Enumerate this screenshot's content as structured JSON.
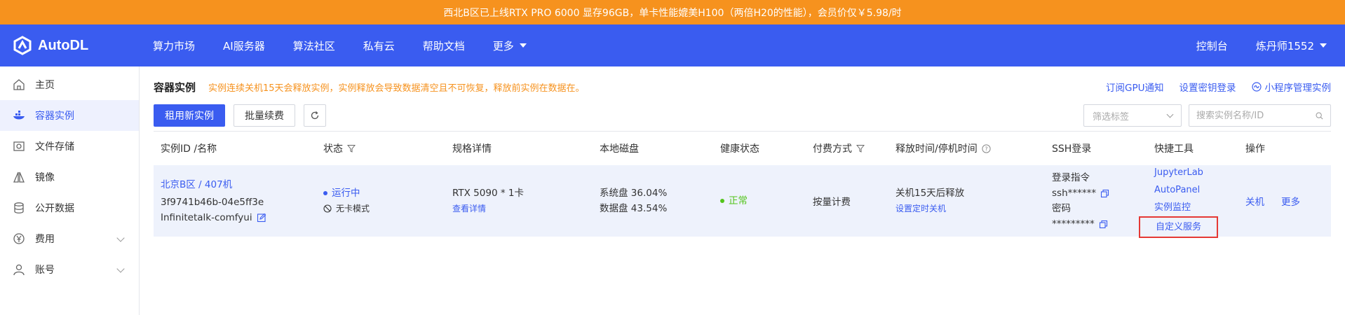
{
  "banner": {
    "text": "西北B区已上线RTX PRO 6000 显存96GB，单卡性能媲美H100（两倍H20的性能），会员价仅￥5.98/时"
  },
  "topnav": {
    "logo": "AutoDL",
    "items": [
      {
        "label": "算力市场"
      },
      {
        "label": "AI服务器"
      },
      {
        "label": "算法社区"
      },
      {
        "label": "私有云"
      },
      {
        "label": "帮助文档"
      },
      {
        "label": "更多"
      }
    ],
    "console": "控制台",
    "user": "炼丹师1552"
  },
  "sidebar": {
    "items": [
      {
        "label": "主页",
        "icon": "home-icon"
      },
      {
        "label": "容器实例",
        "icon": "container-icon"
      },
      {
        "label": "文件存储",
        "icon": "storage-icon"
      },
      {
        "label": "镜像",
        "icon": "mirror-icon"
      },
      {
        "label": "公开数据",
        "icon": "database-icon"
      },
      {
        "label": "费用",
        "icon": "yen-icon"
      },
      {
        "label": "账号",
        "icon": "user-icon"
      }
    ]
  },
  "main": {
    "title": "容器实例",
    "warning": "实例连续关机15天会释放实例，实例释放会导致数据清空且不可恢复，释放前实例在数据在。",
    "links": {
      "gpu_notify": "订阅GPU通知",
      "set_key": "设置密钥登录",
      "miniprogram": "小程序管理实例"
    },
    "toolbar": {
      "new_instance": "租用新实例",
      "batch_renew": "批量续费",
      "filter_placeholder": "筛选标签",
      "search_placeholder": "搜索实例名称/ID"
    },
    "table": {
      "headers": [
        "实例ID /名称",
        "状态",
        "规格详情",
        "本地磁盘",
        "健康状态",
        "付费方式",
        "释放时间/停机时间",
        "SSH登录",
        "快捷工具",
        "操作"
      ],
      "row": {
        "region": "北京B区 / 407机",
        "id": "3f9741b46b-04e5ff3e",
        "name": "Infinitetalk-comfyui",
        "status": "运行中",
        "mode": "无卡模式",
        "spec": "RTX 5090 * 1卡",
        "spec_link": "查看详情",
        "disk_sys": "系统盘 36.04%",
        "disk_data": "数据盘 43.54%",
        "health": "正常",
        "billing": "按量计费",
        "release": "关机15天后释放",
        "release_link": "设置定时关机",
        "ssh_cmd_label": "登录指令",
        "ssh_cmd": "ssh******",
        "ssh_pwd_label": "密码",
        "ssh_pwd": "*********",
        "tools": [
          "JupyterLab",
          "AutoPanel",
          "实例监控",
          "自定义服务"
        ],
        "op_shutdown": "关机",
        "op_more": "更多"
      }
    }
  },
  "colors": {
    "banner": "#f6921e",
    "brand": "#3a5cf0",
    "warning": "#f6921e",
    "healthy": "#52c41a",
    "highlight": "#e53935"
  }
}
